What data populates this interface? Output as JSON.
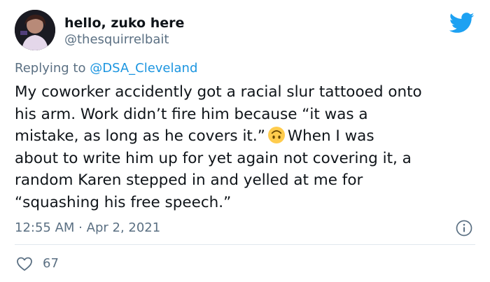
{
  "author": {
    "display_name": "hello, zuko here",
    "handle": "@thesquirrelbait"
  },
  "reply": {
    "prefix": "Replying to ",
    "mention": "@DSA_Cleveland"
  },
  "tweet": {
    "line1": "My coworker accidently got a racial slur tattooed onto",
    "line2": "his arm. Work didn’t fire him because “it was a",
    "line3_before_emoji": "mistake, as long as he covers it.”",
    "line3_after_emoji": "When I was",
    "line4": "about to write him up for yet again not covering it, a",
    "line5": "random Karen stepped in and yelled at me for",
    "line6": "“squashing his free speech.”",
    "emoji": "upside-down-face-emoji"
  },
  "meta": {
    "time": "12:55 AM",
    "separator": " · ",
    "date": "Apr 2, 2021"
  },
  "engagement": {
    "likes": "67"
  },
  "icons": {
    "logo": "twitter-bird-icon",
    "info": "info-icon",
    "like": "heart-icon"
  },
  "colors": {
    "brand_blue": "#1da1f2",
    "mention_blue": "#1b95e0",
    "secondary_text": "#5b7083",
    "emoji_yellow": "#ffcc4d"
  }
}
